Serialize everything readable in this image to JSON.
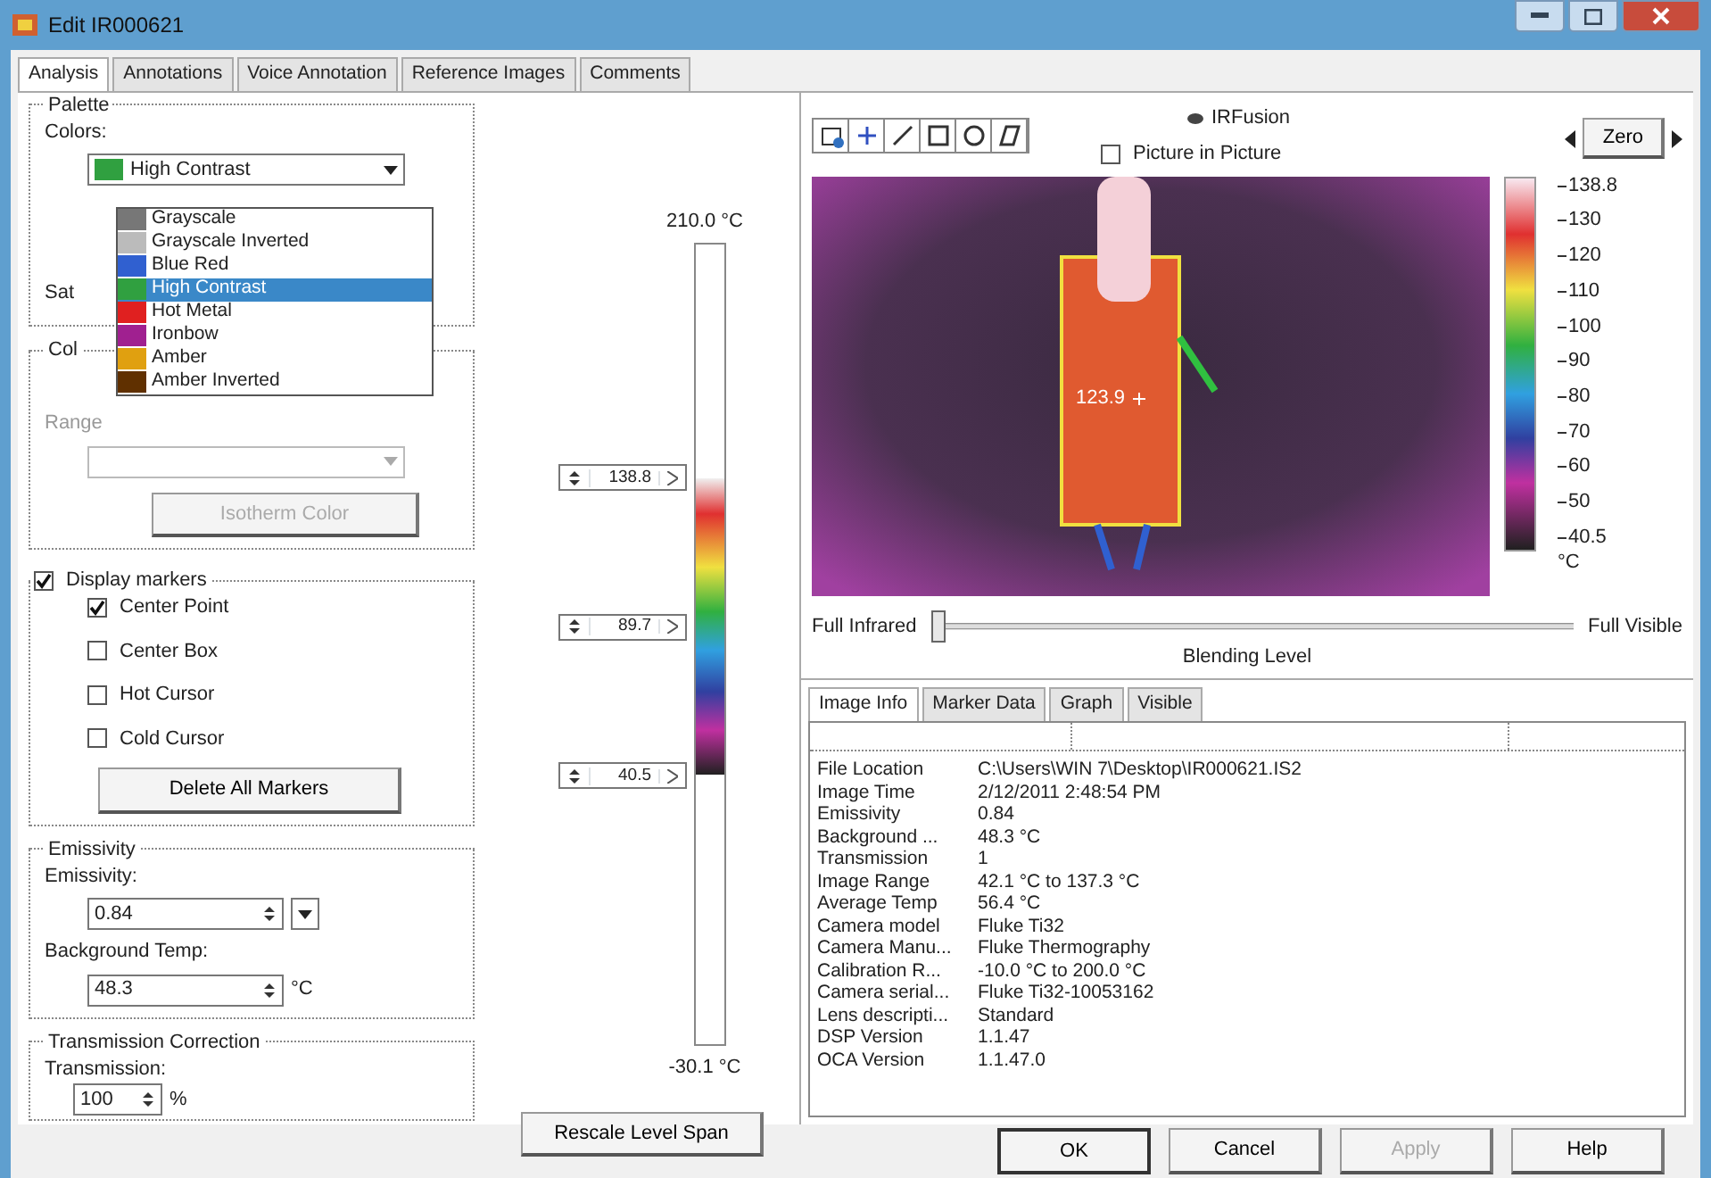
{
  "window": {
    "title": "Edit IR000621"
  },
  "tabs": [
    {
      "label": "Analysis",
      "selected": true
    },
    {
      "label": "Annotations",
      "selected": false
    },
    {
      "label": "Voice Annotation",
      "selected": false
    },
    {
      "label": "Reference Images",
      "selected": false
    },
    {
      "label": "Comments",
      "selected": false
    }
  ],
  "palette": {
    "title": "Palette",
    "colors_label": "Colors:",
    "value": "High Contrast",
    "saturation_label": "Sat",
    "options": [
      {
        "label": "Grayscale",
        "selected": false,
        "color": "#777777"
      },
      {
        "label": "Grayscale Inverted",
        "selected": false,
        "color": "#bbbbbb"
      },
      {
        "label": "Blue Red",
        "selected": false,
        "color": "#3060d0"
      },
      {
        "label": "High Contrast",
        "selected": true,
        "color": "#30a040"
      },
      {
        "label": "Hot Metal",
        "selected": false,
        "color": "#e02020"
      },
      {
        "label": "Ironbow",
        "selected": false,
        "color": "#a02090"
      },
      {
        "label": "Amber",
        "selected": false,
        "color": "#e0a010"
      },
      {
        "label": "Amber Inverted",
        "selected": false,
        "color": "#603000"
      }
    ]
  },
  "color_alarm": {
    "title": "Col",
    "range_label": "Range",
    "isotherm_button": {
      "label": "Isotherm Color",
      "disabled": true
    }
  },
  "markers": {
    "label": "Display markers",
    "checked": true,
    "items": [
      {
        "label": "Center Point",
        "checked": true
      },
      {
        "label": "Center Box",
        "checked": false
      },
      {
        "label": "Hot Cursor",
        "checked": false
      },
      {
        "label": "Cold Cursor",
        "checked": false
      }
    ],
    "delete_button": "Delete All Markers"
  },
  "emissivity": {
    "title": "Emissivity",
    "emissivity_label": "Emissivity:",
    "emissivity_value": "0.84",
    "background_label": "Background Temp:",
    "background_value": "48.3",
    "background_unit": "°C"
  },
  "transmission": {
    "title": "Transmission Correction",
    "label": "Transmission:",
    "value": "100",
    "unit": "%"
  },
  "level_span": {
    "max": "210.0 °C",
    "min": "-30.1 °C",
    "rescale_button": "Rescale Level  Span",
    "markers": [
      "138.8",
      "89.7",
      "40.5"
    ]
  },
  "image_panel": {
    "irfusion_label": "IRFusion",
    "pip_label": "Picture in Picture",
    "pip_checked": false,
    "zero_label": "Zero",
    "marker_reading": "123.9",
    "scale_ticks": [
      "138.8",
      "130",
      "120",
      "110",
      "100",
      "90",
      "80",
      "70",
      "60",
      "50",
      "40.5"
    ],
    "scale_unit": "°C",
    "blending": {
      "left_label": "Full Infrared",
      "right_label": "Full Visible",
      "caption": "Blending Level",
      "level": 0
    }
  },
  "info_tabs": [
    {
      "label": "Image Info",
      "selected": true
    },
    {
      "label": "Marker Data",
      "selected": false
    },
    {
      "label": "Graph",
      "selected": false
    },
    {
      "label": "Visible",
      "selected": false
    }
  ],
  "info_rows": [
    {
      "label": "File Location",
      "value": "C:\\Users\\WIN 7\\Desktop\\IR000621.IS2"
    },
    {
      "label": "Image Time",
      "value": "2/12/2011 2:48:54 PM"
    },
    {
      "label": "Emissivity",
      "value": "0.84"
    },
    {
      "label": "Background ...",
      "value": "48.3 °C"
    },
    {
      "label": "Transmission",
      "value": "1"
    },
    {
      "label": "Image Range",
      "value": "42.1 °C to 137.3 °C"
    },
    {
      "label": "Average Temp",
      "value": "56.4 °C"
    },
    {
      "label": "Camera model",
      "value": "Fluke Ti32"
    },
    {
      "label": "Camera Manu...",
      "value": "Fluke Thermography"
    },
    {
      "label": "Calibration R...",
      "value": "-10.0 °C to 200.0 °C"
    },
    {
      "label": "Camera serial...",
      "value": "Fluke Ti32-10053162"
    },
    {
      "label": "Lens descripti...",
      "value": "Standard"
    },
    {
      "label": "DSP Version",
      "value": "1.1.47"
    },
    {
      "label": "OCA Version",
      "value": "1.1.47.0"
    }
  ],
  "buttons": [
    {
      "label": "OK",
      "default": true,
      "disabled": false
    },
    {
      "label": "Cancel",
      "default": false,
      "disabled": false
    },
    {
      "label": "Apply",
      "default": false,
      "disabled": true
    },
    {
      "label": "Help",
      "default": false,
      "disabled": false
    }
  ]
}
